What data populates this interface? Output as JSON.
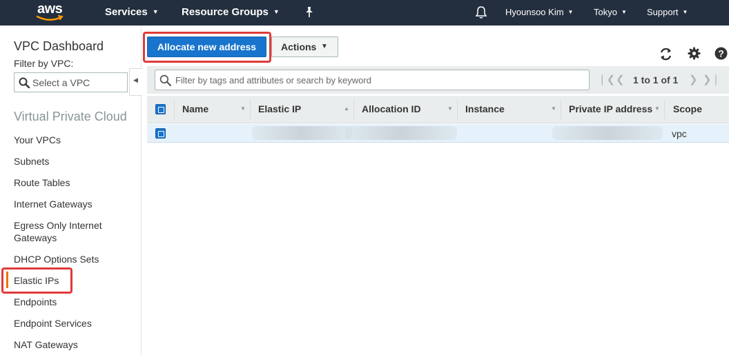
{
  "topnav": {
    "logo_text": "aws",
    "services": "Services",
    "resource_groups": "Resource Groups",
    "user": "Hyounsoo Kim",
    "region": "Tokyo",
    "support": "Support"
  },
  "sidebar": {
    "title": "VPC Dashboard",
    "filter_label": "Filter by VPC:",
    "select_placeholder": "Select a VPC",
    "section": "Virtual Private Cloud",
    "items": [
      {
        "label": "Your VPCs"
      },
      {
        "label": "Subnets"
      },
      {
        "label": "Route Tables"
      },
      {
        "label": "Internet Gateways"
      },
      {
        "label": "Egress Only Internet Gateways"
      },
      {
        "label": "DHCP Options Sets"
      },
      {
        "label": "Elastic IPs"
      },
      {
        "label": "Endpoints"
      },
      {
        "label": "Endpoint Services"
      },
      {
        "label": "NAT Gateways"
      }
    ],
    "active_item": "Elastic IPs"
  },
  "toolbar": {
    "allocate_label": "Allocate new address",
    "actions_label": "Actions"
  },
  "filter": {
    "placeholder": "Filter by tags and attributes or search by keyword"
  },
  "pager": {
    "text": "1 to 1 of 1"
  },
  "table": {
    "columns": [
      {
        "label": "Name"
      },
      {
        "label": "Elastic IP"
      },
      {
        "label": "Allocation ID"
      },
      {
        "label": "Instance"
      },
      {
        "label": "Private IP address"
      },
      {
        "label": "Scope"
      }
    ],
    "sorted_column": "Elastic IP",
    "rows": [
      {
        "name": "",
        "elastic_ip": "",
        "allocation_id": "",
        "instance": "",
        "private_ip": "",
        "scope": "vpc"
      }
    ]
  },
  "colors": {
    "nav_bg": "#232f3e",
    "primary": "#1874cc",
    "highlight": "#e03a3a",
    "active_marker": "#ec7211"
  }
}
